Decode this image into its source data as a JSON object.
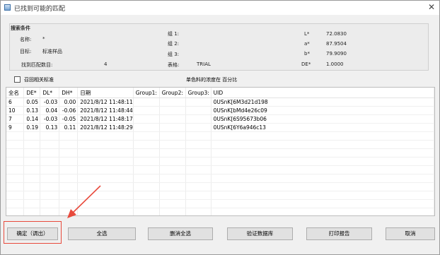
{
  "window": {
    "title": "已找到可能的匹配"
  },
  "search": {
    "group_title": "搜索条件",
    "name_label": "名称:",
    "name_value": "*",
    "target_label": "目标:",
    "target_value": "标准样品",
    "match_count_label": "找到匹配数目:",
    "match_count_value": "4",
    "group1_label": "组 1:",
    "group2_label": "组 2:",
    "group3_label": "组 3:",
    "table_label": "表格:",
    "table_value": "TRIAL",
    "L_label": "L*",
    "L_value": "72.0830",
    "a_label": "a*",
    "a_value": "87.9504",
    "b_label": "b*",
    "b_value": "79.9090",
    "DE_label": "DE*",
    "DE_value": "1.0000"
  },
  "recall_label": "召回相关标准",
  "unit_caption": "单色料的浓度在 百分比",
  "table": {
    "headers": [
      "全名",
      "DE*",
      "DL*",
      "DH*",
      "日期",
      "Group1:",
      "Group2:",
      "Group3:",
      "UID"
    ],
    "rows": [
      [
        "6",
        "0.05",
        "-0.03",
        "0.00",
        "2021/8/12 11:48:11",
        "",
        "",
        "",
        "0USnK[6M3d21d198"
      ],
      [
        "10",
        "0.13",
        "0.04",
        "-0.06",
        "2021/8/12 11:48:44",
        "",
        "",
        "",
        "0USnK[bMd4e26c09"
      ],
      [
        "7",
        "0.14",
        "-0.03",
        "-0.05",
        "2021/8/12 11:48:17",
        "",
        "",
        "",
        "0USnK[6S95673b06"
      ],
      [
        "9",
        "0.19",
        "0.13",
        "0.11",
        "2021/8/12 11:48:29",
        "",
        "",
        "",
        "0USnK[6Y6a946c13"
      ]
    ]
  },
  "buttons": {
    "confirm": "确定（调出）",
    "select_all": "全选",
    "deselect_all": "删消全选",
    "verify_db": "验证数据库",
    "print_report": "打印报告",
    "cancel": "取消"
  },
  "colors": {
    "highlight": "#e84a3c"
  }
}
